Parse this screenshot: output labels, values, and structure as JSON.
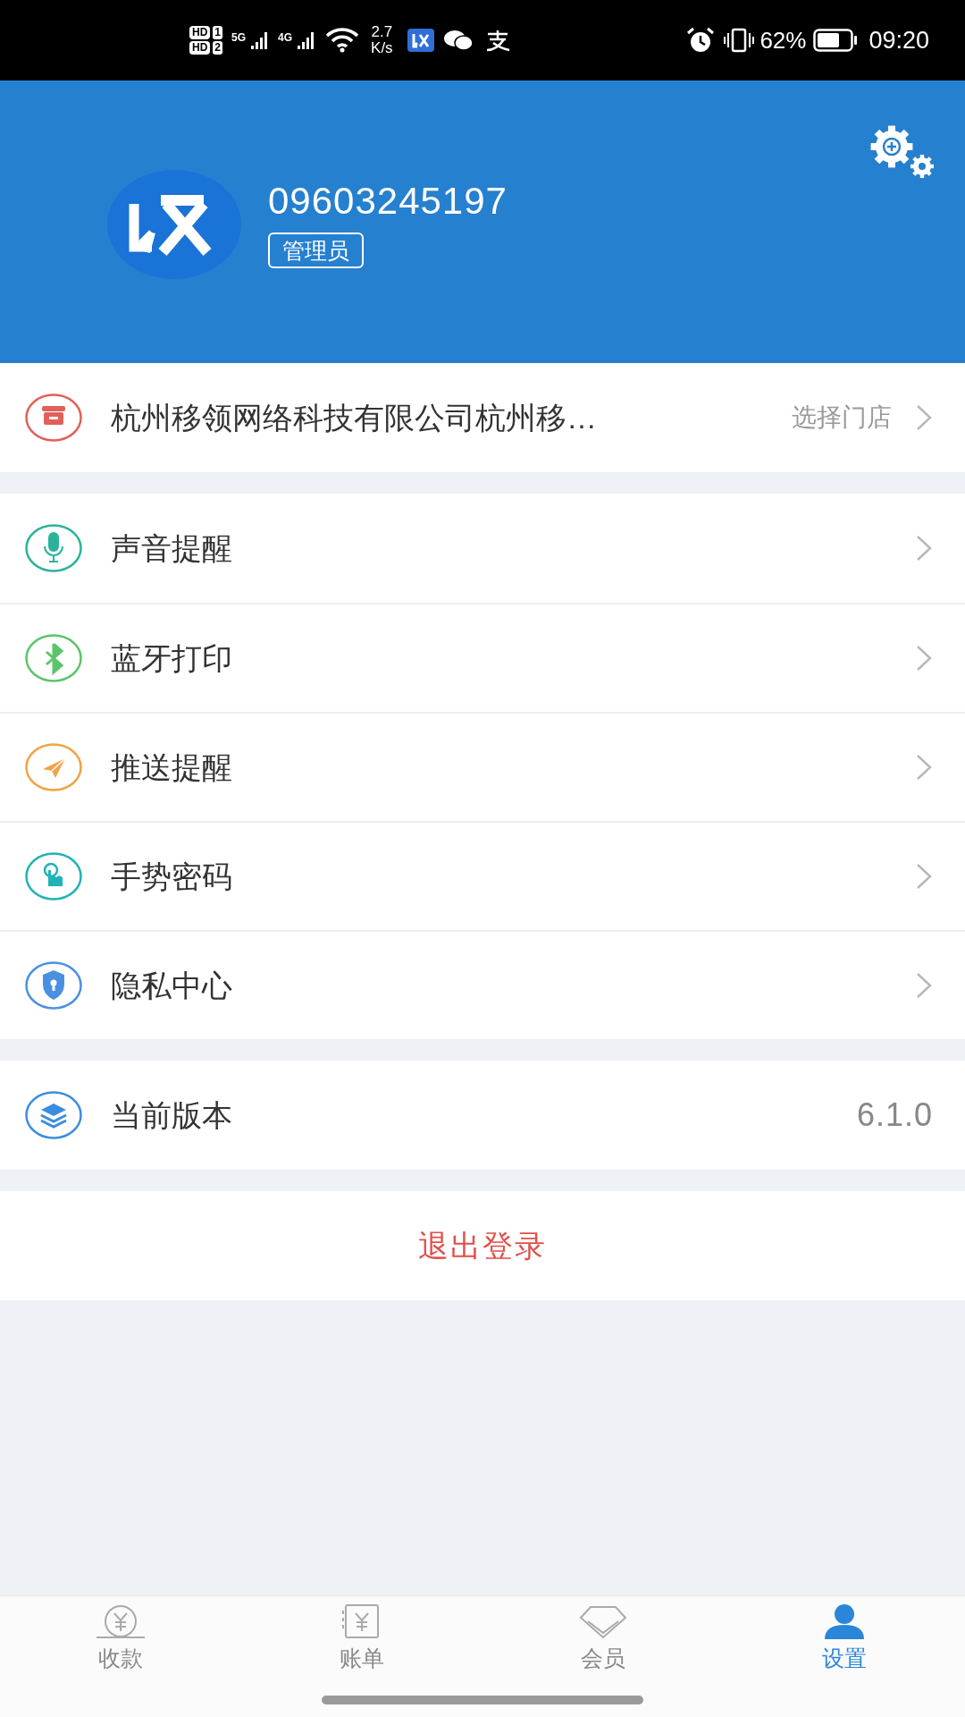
{
  "status_bar": {
    "sim_labels": [
      {
        "hd": "HD",
        "slot": "1"
      },
      {
        "hd": "HD",
        "slot": "2"
      }
    ],
    "network_types": [
      "5G",
      "4G"
    ],
    "speed": {
      "value": "2.7",
      "unit": "K/s"
    },
    "battery_percent": "62%",
    "time": "09:20"
  },
  "profile": {
    "account": "09603245197",
    "role": "管理员"
  },
  "sections": [
    [
      {
        "kind": "store",
        "label": "杭州移领网络科技有限公司杭州移…",
        "action": "选择门店"
      }
    ],
    [
      {
        "kind": "link",
        "label": "声音提醒"
      },
      {
        "kind": "link",
        "label": "蓝牙打印"
      },
      {
        "kind": "link",
        "label": "推送提醒"
      },
      {
        "kind": "link",
        "label": "手势密码"
      },
      {
        "kind": "link",
        "label": "隐私中心"
      }
    ],
    [
      {
        "kind": "version",
        "label": "当前版本",
        "value": "6.1.0"
      }
    ]
  ],
  "logout": "退出登录",
  "tabs": [
    {
      "label": "收款",
      "selected": false
    },
    {
      "label": "账单",
      "selected": false
    },
    {
      "label": "会员",
      "selected": false
    },
    {
      "label": "设置",
      "selected": true
    }
  ]
}
